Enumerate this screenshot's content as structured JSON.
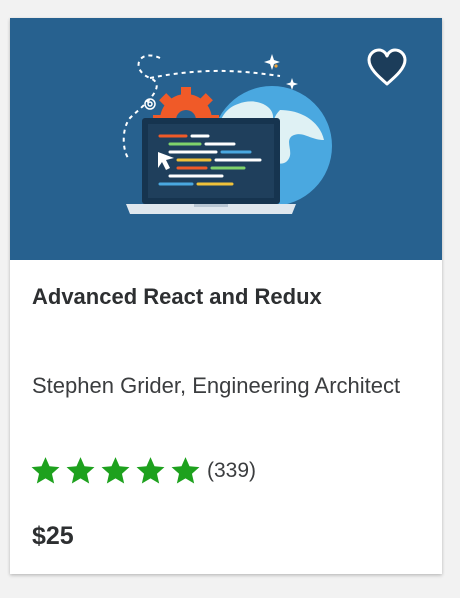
{
  "course": {
    "title": "Advanced React and Redux",
    "instructor": "Stephen Grider, Engineering Architect",
    "rating": {
      "stars_filled": 5,
      "stars_total": 5,
      "count_label": "(339)"
    },
    "price": "$25"
  },
  "icons": {
    "wishlist": "heart-outline-icon",
    "star": "star-icon"
  },
  "colors": {
    "thumbnail_bg": "#27618f",
    "star": "#1ea11e",
    "title": "#2d2f31",
    "heart_fill": "#1c3d5a"
  }
}
